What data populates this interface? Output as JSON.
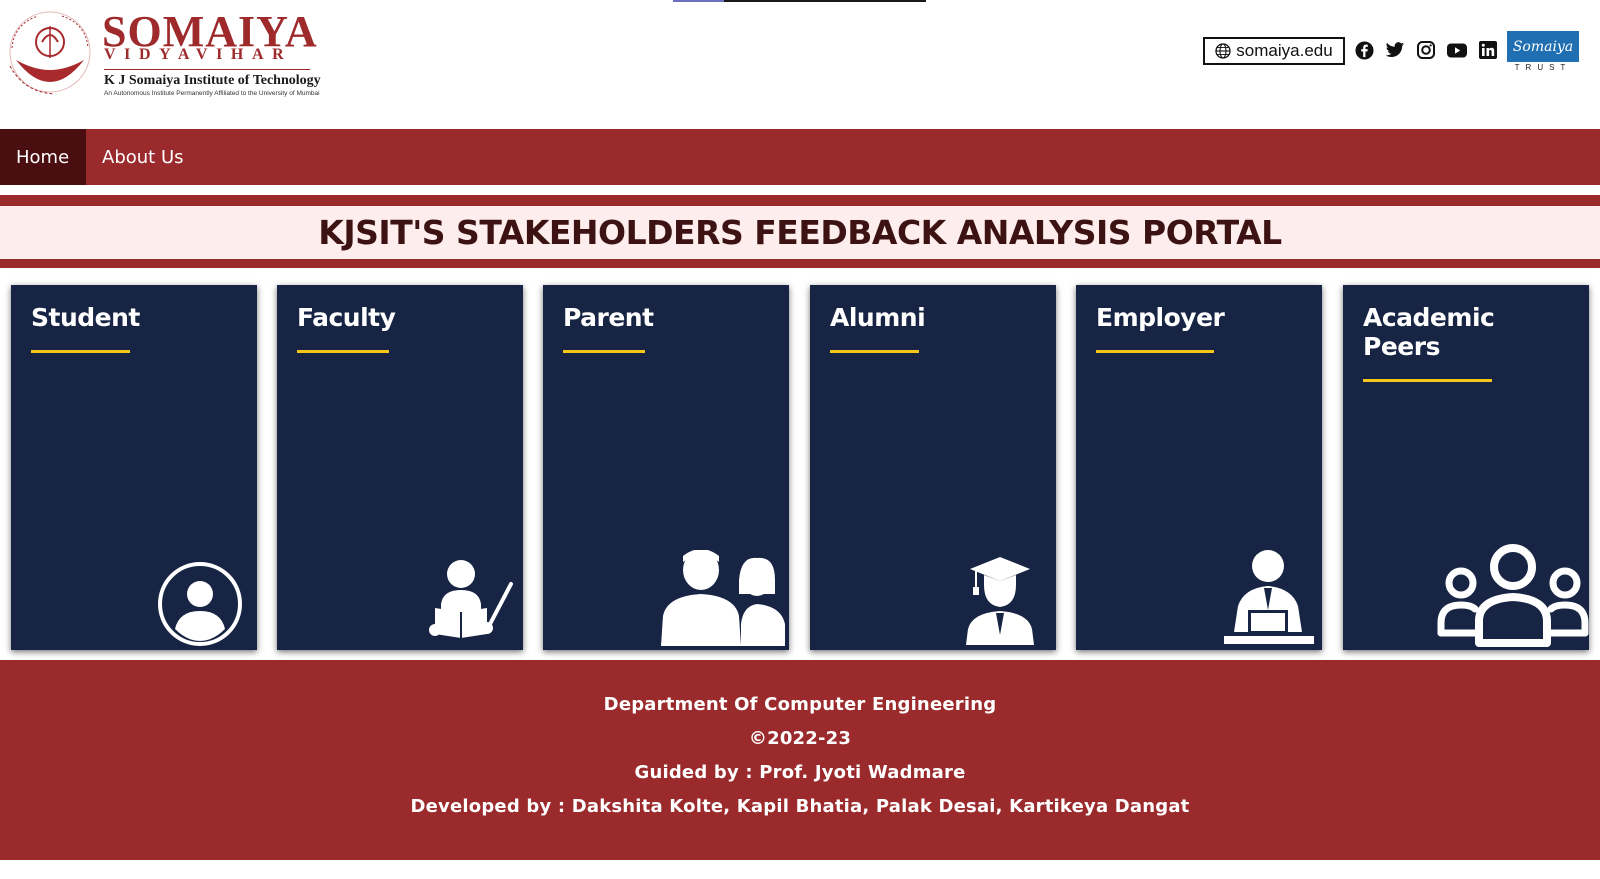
{
  "header": {
    "brand_name": "SOMAIYA",
    "brand_sub": "VIDYAVIHAR",
    "institute": "K J Somaiya Institute of Technology",
    "tagline": "An Autonomous Institute Permanently Affiliated to the University of Mumbai",
    "site_link": "somaiya.edu",
    "social_icons": [
      "facebook-icon",
      "twitter-icon",
      "instagram-icon",
      "youtube-icon",
      "linkedin-icon"
    ],
    "trust_logo_text": "Somaiya",
    "trust_label": "TRUST"
  },
  "nav": {
    "items": [
      {
        "label": "Home",
        "active": true
      },
      {
        "label": "About Us",
        "active": false
      }
    ]
  },
  "banner": {
    "title": "KJSIT'S STAKEHOLDERS FEEDBACK ANALYSIS PORTAL"
  },
  "cards": [
    {
      "title": "Student",
      "icon": "student-icon"
    },
    {
      "title": "Faculty",
      "icon": "faculty-icon"
    },
    {
      "title": "Parent",
      "icon": "parent-icon"
    },
    {
      "title": "Alumni",
      "icon": "alumni-icon"
    },
    {
      "title": "Employer",
      "icon": "employer-icon"
    },
    {
      "title": "Academic Peers",
      "icon": "academic-peers-icon"
    }
  ],
  "footer": {
    "department": "Department Of Computer Engineering",
    "copyright": "©2022-23",
    "guided_by": "Guided by : Prof. Jyoti Wadmare",
    "developed_by": "Developed by : Dakshita Kolte, Kapil Bhatia, Palak Desai, Kartikeya Dangat"
  },
  "colors": {
    "maroon": "#9b2a2c",
    "dark_maroon": "#4a0d10",
    "navy": "#172444",
    "gold": "#f5c518",
    "banner_bg": "#fdeeed"
  }
}
